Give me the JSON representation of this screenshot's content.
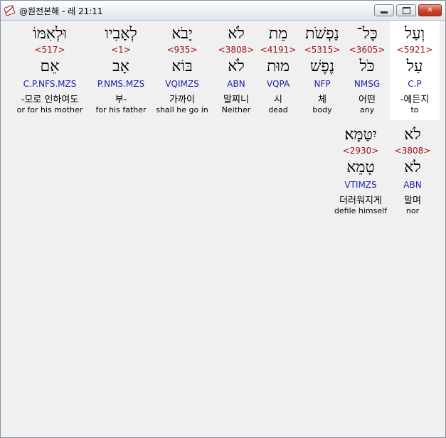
{
  "window": {
    "title": "@원전본해 - 레 21:11",
    "controls": {
      "minimize": "",
      "maximize": "",
      "close": "✕"
    },
    "colors": {
      "hebrew": "#000000",
      "strong": "#a01010",
      "parse": "#1c1cb0"
    }
  },
  "verse": {
    "words": [
      {
        "hebrew": "וְעַל",
        "strong": "<5921>",
        "root": "עַל",
        "parse": "C.P",
        "korean": "-에든지",
        "english": "to",
        "selected": true
      },
      {
        "hebrew": "כָּל־",
        "strong": "<3605>",
        "root": "כֹּל",
        "parse": "NMSG",
        "korean": "어떤",
        "english": "any",
        "selected": false
      },
      {
        "hebrew": "נַפְשֹׁת",
        "strong": "<5315>",
        "root": "נֶפֶשׁ",
        "parse": "NFP",
        "korean": "체",
        "english": "body",
        "selected": false
      },
      {
        "hebrew": "מֵת",
        "strong": "<4191>",
        "root": "מוּת",
        "parse": "VQPA",
        "korean": "시",
        "english": "dead",
        "selected": false
      },
      {
        "hebrew": "לֹא",
        "strong": "<3808>",
        "root": "לֹא",
        "parse": "ABN",
        "korean": "말찌니",
        "english": "Neither",
        "selected": false
      },
      {
        "hebrew": "יָבֹא",
        "strong": "<935>",
        "root": "בּוֹא",
        "parse": "VQIMZS",
        "korean": "가까이",
        "english": "shall he go in",
        "selected": false
      },
      {
        "hebrew": "לְאָבִיו",
        "strong": "<1>",
        "root": "אָב",
        "parse": "P.NMS.MZS",
        "korean": "부-",
        "english": "for his father",
        "selected": false
      },
      {
        "hebrew": "וּלְאִמּוֹ",
        "strong": "<517>",
        "root": "אֵם",
        "parse": "C.P.NFS.MZS",
        "korean": "-모로 인하여도",
        "english": "or for his mother",
        "selected": false
      },
      {
        "hebrew": "לֹא",
        "strong": "<3808>",
        "root": "לֹא",
        "parse": "ABN",
        "korean": "말며",
        "english": "nor",
        "selected": false
      },
      {
        "hebrew": "יִטַּמָּא׃",
        "strong": "<2930>",
        "root": "טָמֵא",
        "parse": "VTIMZS",
        "korean": "더러워지게",
        "english": "defile himself",
        "selected": false
      }
    ]
  }
}
